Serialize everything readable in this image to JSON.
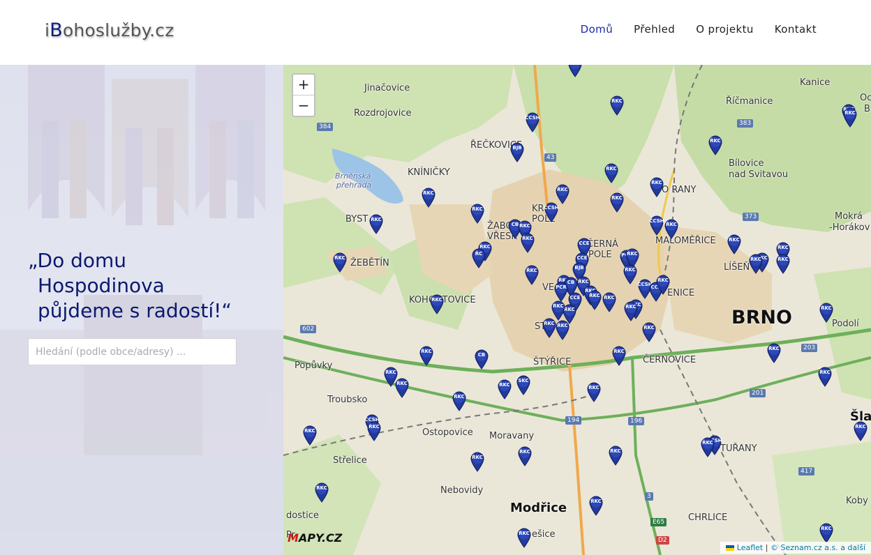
{
  "header": {
    "brand_prefix": "i",
    "brand_initial": "B",
    "brand_rest": "ohoslužby.cz",
    "nav": [
      {
        "label": "Domů",
        "active": true
      },
      {
        "label": "Přehled",
        "active": false
      },
      {
        "label": "O projektu",
        "active": false
      },
      {
        "label": "Kontakt",
        "active": false
      }
    ]
  },
  "hero": {
    "quote_line1": "„Do domu",
    "quote_line2": "Hospodinova",
    "quote_line3": "půjdeme s radostí!“",
    "search_placeholder": "Hledání (podle obce/adresy) ..."
  },
  "map": {
    "zoom_in": "+",
    "zoom_out": "−",
    "places": {
      "jinacovice": "Jinačovice",
      "rozdrojovice": "Rozdrojovice",
      "reckovice": "ŘEČKOVICE",
      "kninicky": "KNÍNIČKY",
      "prehrada1": "Brněnská",
      "prehrada2": "přehrada",
      "bystrc": "BYST",
      "zabovresky": "ŽABO",
      "vresky": "VŘESK",
      "zebetin": "ŽEBĚTÍN",
      "kohoutovice": "KOHOUTOVICE",
      "popuvky": "Popůvky",
      "troubsko": "Troubsko",
      "ostopovice": "Ostopovice",
      "moravany": "Moravany",
      "strelice": "Střelice",
      "nebovidy": "Nebovidy",
      "modrice": "Modřice",
      "dostice": "dostice",
      "prostice": "Pr",
      "hresice": "ešice",
      "stryce": "ŠTÝŘICE",
      "cernovice": "ČERNOVICE",
      "brno": "BRNO",
      "malomerice": "MALOMĚŘICE",
      "lisen": "LÍŠEŇ",
      "ricmanice": "Říčmanice",
      "kanice": "Kanice",
      "bilovice1": "Bílovice",
      "bilovice2": "nad Svitavou",
      "obrany": "O  RANY",
      "mokra1": "Mokrá",
      "mokra2": "-Horákov",
      "chrlice": "CHRLICE",
      "turany": "TUŘANY",
      "podoli": "Podolí",
      "slap": "Šla",
      "koby": "Koby",
      "cerna_pole1": "ČERNÁ",
      "cerna_pole2": "POLE",
      "krpole1": "KR",
      "krpole2": "POLE",
      "vever": "VE",
      "stbrno": "ST",
      "jenice": "ENICE",
      "ocec": "Oc",
      "ocecb": "B"
    },
    "roads": [
      "384",
      "43",
      "383",
      "373",
      "602",
      "203",
      "201",
      "194",
      "196",
      "417",
      "3",
      "E65",
      "D2"
    ],
    "markers": [
      "ŘKC",
      "ČCSH",
      "BJB",
      "CB",
      "CCE",
      "PCR",
      "SKC",
      "ŘC"
    ],
    "logo_text": "APY.CZ",
    "logo_initial": "M",
    "attribution_leaflet": "Leaflet",
    "attribution_sep": "|",
    "attribution_rest": "© Seznam.cz a.s. a další"
  }
}
